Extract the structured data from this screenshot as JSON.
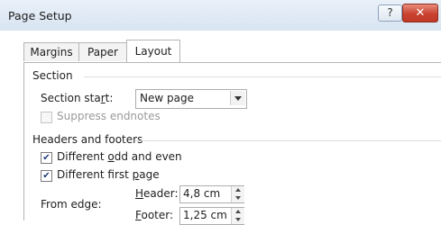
{
  "window": {
    "title": "Page Setup",
    "help_label": "?",
    "close_label": "✕"
  },
  "tabs": [
    {
      "label": "Margins"
    },
    {
      "label": "Paper"
    },
    {
      "label": "Layout"
    }
  ],
  "section": {
    "title": "Section",
    "start_label_prefix": "Section sta",
    "start_label_mnemonic": "r",
    "start_label_suffix": "t:",
    "start_value": "New page",
    "suppress_endnotes_label": "Suppress endnotes",
    "suppress_endnotes_checked": false
  },
  "headers_footers": {
    "title": "Headers and footers",
    "odd_even_prefix": "Different ",
    "odd_even_mnemonic": "o",
    "odd_even_suffix": "dd and even",
    "odd_even_checked": true,
    "first_page_prefix": "Different first ",
    "first_page_mnemonic": "p",
    "first_page_suffix": "age",
    "first_page_checked": true,
    "from_edge_label": "From edge:",
    "header_mnemonic": "H",
    "header_label_rest": "eader:",
    "header_value": "4,8 cm",
    "footer_mnemonic": "F",
    "footer_label_rest": "ooter:",
    "footer_value": "1,25 cm"
  },
  "check_glyph": "✔"
}
